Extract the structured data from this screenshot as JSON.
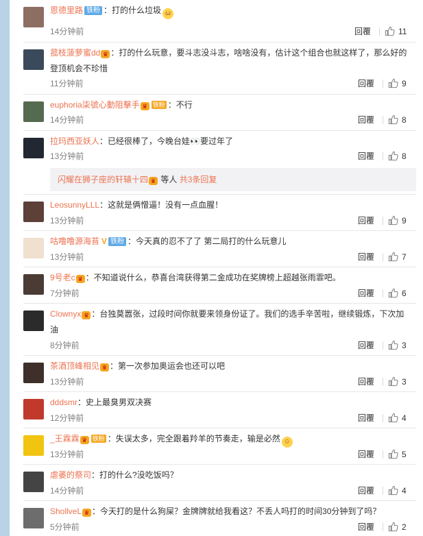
{
  "comments": [
    {
      "user": "恩德里路",
      "badge": "铁粉",
      "vip": null,
      "vcheck": false,
      "text": "：打的什么垃圾",
      "emoji": "cat-face",
      "time": "14分钟前",
      "reply": "回覆",
      "likes": "11",
      "avatar": "#8d6e63"
    },
    {
      "user": "菰枝菠萝蜜dd",
      "badge": null,
      "vip": "icon",
      "vcheck": false,
      "text": "：打的什么玩意，要斗志没斗志，啥啥没有，估计这个组合也就这样了，那么好的登顶机会不珍惜",
      "emoji": null,
      "time": "11分钟前",
      "reply": "回覆",
      "likes": "9",
      "avatar": "#3a4a5a"
    },
    {
      "user": "euphoria柒號心動阻擊手",
      "badge": null,
      "vip": "铁粉",
      "vcheck": false,
      "text": "：不行",
      "emoji": null,
      "time": "14分钟前",
      "reply": "回覆",
      "likes": "8",
      "avatar": "#556b4f"
    },
    {
      "user": "拉玛西亚妖人",
      "badge": null,
      "vip": null,
      "vcheck": false,
      "text": "：已经很棒了，今晚台娃👀要过年了",
      "emoji": null,
      "time": "13分钟前",
      "reply": "回覆",
      "likes": "8",
      "avatar": "#222831"
    },
    {
      "user": "LeosunnyLLL",
      "badge": null,
      "vip": null,
      "vcheck": false,
      "text": "：这就是俩憎逼！没有一点血腥！",
      "emoji": null,
      "time": "13分钟前",
      "reply": "回覆",
      "likes": "9",
      "avatar": "#5d4037"
    },
    {
      "user": "咕噜噜源海苔",
      "badge": "铁粉",
      "vip": null,
      "vcheck": true,
      "text": "：今天真的忍不了了 第二局打的什么玩意儿",
      "emoji": null,
      "time": "13分钟前",
      "reply": "回覆",
      "likes": "7",
      "avatar": "#f0e0d0"
    },
    {
      "user": "9号老c",
      "badge": null,
      "vip": "icon",
      "vcheck": false,
      "text": "：不知道说什么，恭喜台湾获得第二金成功在奖牌榜上超越张雨霏吧。",
      "emoji": null,
      "time": "7分钟前",
      "reply": "回覆",
      "likes": "6",
      "avatar": "#4a3b35"
    },
    {
      "user": "Clownyx",
      "badge": null,
      "vip": "icon",
      "vcheck": false,
      "text": "：台独莫嚣张，过段时间你就要来领身份证了。我们的选手辛苦啦，继续锻炼，下次加油",
      "emoji": null,
      "time": "8分钟前",
      "reply": "回覆",
      "likes": "3",
      "avatar": "#2b2b2b"
    },
    {
      "user": "茶酒顶峰相见",
      "badge": null,
      "vip": "icon",
      "vcheck": false,
      "text": "：第一次参加奥运会也还可以吧",
      "emoji": null,
      "time": "13分钟前",
      "reply": "回覆",
      "likes": "3",
      "avatar": "#3e2f2a"
    },
    {
      "user": "dddsmr",
      "badge": null,
      "vip": null,
      "vcheck": false,
      "text": "：史上最臭男双决赛",
      "emoji": null,
      "time": "12分钟前",
      "reply": "回覆",
      "likes": "4",
      "avatar": "#c0392b"
    },
    {
      "user": "_王霖霖",
      "badge": null,
      "vip": "铁粉",
      "vcheck": false,
      "text": "：失误太多，完全跟着羚羊的节奏走，输是必然",
      "emoji": "hug",
      "time": "13分钟前",
      "reply": "回覆",
      "likes": "5",
      "avatar": "#f1c40f"
    },
    {
      "user": "虐萎的祭司",
      "badge": null,
      "vip": null,
      "vcheck": false,
      "text": "：打的什么?没吃饭吗？",
      "emoji": null,
      "time": "14分钟前",
      "reply": "回覆",
      "likes": "4",
      "avatar": "#444"
    },
    {
      "user": "ShollveL",
      "badge": null,
      "vip": "icon",
      "vcheck": false,
      "text": "：今天打的是什么狗屎？金牌牌就给我看这？不丢人吗打的时间30分钟到了吗？",
      "emoji": null,
      "time": "5分钟前",
      "reply": "回覆",
      "likes": "2",
      "avatar": "#6d6d6d"
    }
  ],
  "subreply": {
    "user": "闪耀在狮子座的轩辕十四",
    "mid": "等人",
    "link": "共3条回复"
  },
  "colors": {
    "username": "#eb7350",
    "background": "#b8d3e6"
  }
}
